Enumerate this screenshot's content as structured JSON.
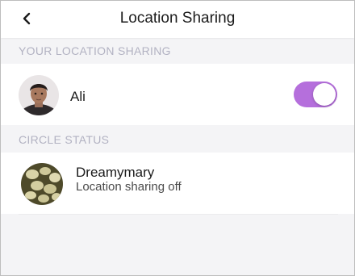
{
  "navbar": {
    "title": "Location Sharing",
    "back_icon": "chevron-left-icon"
  },
  "your_sharing": {
    "header": "YOUR LOCATION SHARING",
    "user": {
      "name": "Ali",
      "sharing_on": true
    }
  },
  "circle_status": {
    "header": "CIRCLE STATUS",
    "members": [
      {
        "name": "Dreamymary",
        "status": "Location sharing off"
      }
    ]
  },
  "colors": {
    "toggle_on": "#b56fdc",
    "section_header_text": "#b2b2c2",
    "background": "#f4f4f6"
  }
}
